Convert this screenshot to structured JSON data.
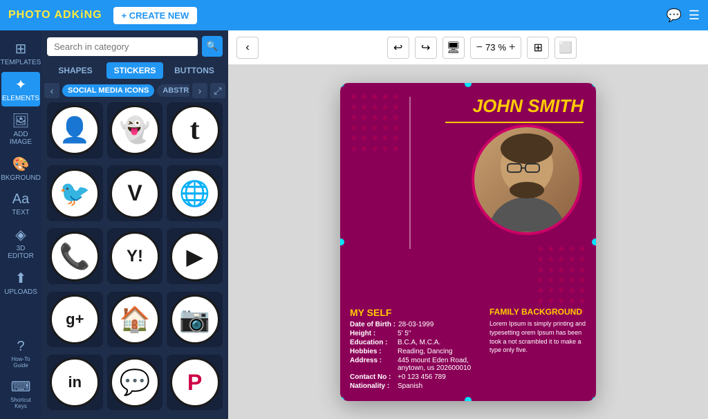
{
  "topbar": {
    "logo": "PHOTO",
    "logo_highlight": "AD",
    "logo_end": "KiNG",
    "create_new_label": "+ CREATE NEW"
  },
  "sidebar": {
    "items": [
      {
        "id": "templates",
        "label": "TEMPLATES",
        "icon": "⊞"
      },
      {
        "id": "elements",
        "label": "ELEMENTS",
        "icon": "✦"
      },
      {
        "id": "add_image",
        "label": "ADD IMAGE",
        "icon": "🖼"
      },
      {
        "id": "background",
        "label": "BKGROUND",
        "icon": "🎨"
      },
      {
        "id": "text",
        "label": "TEXT",
        "icon": "Aa"
      },
      {
        "id": "3d_editor",
        "label": "3D EDITOR",
        "icon": "◈"
      },
      {
        "id": "uploads",
        "label": "UPLOADS",
        "icon": "⬆"
      }
    ],
    "bottom_items": [
      {
        "id": "how_to",
        "label": "How-To Guide",
        "icon": "?"
      },
      {
        "id": "shortcut",
        "label": "Shortcut Keys",
        "icon": "⌨"
      }
    ]
  },
  "panel": {
    "search_placeholder": "Search in category",
    "tabs": [
      {
        "id": "shapes",
        "label": "SHAPES"
      },
      {
        "id": "stickers",
        "label": "STICKERS"
      },
      {
        "id": "buttons",
        "label": "BUTTONS"
      }
    ],
    "active_tab": "stickers",
    "categories": [
      {
        "id": "social_media_icons",
        "label": "SOCIAL MEDIA ICONS",
        "active": true
      },
      {
        "id": "abstract",
        "label": "ABSTRACT",
        "active": false
      }
    ],
    "icons": [
      {
        "id": "user",
        "symbol": "👤"
      },
      {
        "id": "snapchat",
        "symbol": "👻"
      },
      {
        "id": "tumblr",
        "symbol": "t"
      },
      {
        "id": "twitter",
        "symbol": "🐦"
      },
      {
        "id": "vimeo",
        "symbol": "V"
      },
      {
        "id": "globe",
        "symbol": "🌐"
      },
      {
        "id": "phone",
        "symbol": "📞"
      },
      {
        "id": "yahoo",
        "symbol": "Y!"
      },
      {
        "id": "youtube",
        "symbol": "▶"
      },
      {
        "id": "google_plus",
        "symbol": "g+"
      },
      {
        "id": "home",
        "symbol": "🏠"
      },
      {
        "id": "instagram",
        "symbol": "📷"
      },
      {
        "id": "linkedin",
        "symbol": "in"
      },
      {
        "id": "messenger",
        "symbol": "💬"
      },
      {
        "id": "pinterest",
        "symbol": "P"
      }
    ]
  },
  "toolbar": {
    "undo_label": "↩",
    "redo_label": "↪",
    "zoom_value": "73",
    "zoom_unit": "%",
    "zoom_minus": "—",
    "zoom_plus": "+"
  },
  "card": {
    "name": "JOHN SMITH",
    "section_title": "MY SELF",
    "rows": [
      {
        "label": "Date of Birth :",
        "value": "28-03-1999"
      },
      {
        "label": "Height :",
        "value": "5' 5\""
      },
      {
        "label": "Education :",
        "value": "B.C.A, M.C.A."
      },
      {
        "label": "Hobbies :",
        "value": "Reading, Dancing"
      },
      {
        "label": "Address :",
        "value": "445 mount Eden Road, anytown, us 202600010"
      },
      {
        "label": "Contact No :",
        "value": "+0 123 456 789"
      },
      {
        "label": "Nationality :",
        "value": "Spanish"
      }
    ],
    "family_title": "FAMILY BACKGROUND",
    "family_text": "Lorem Ipsum is simply printing and typesetting orem Ipsum has been took a not scrambled it to make a type only five."
  }
}
